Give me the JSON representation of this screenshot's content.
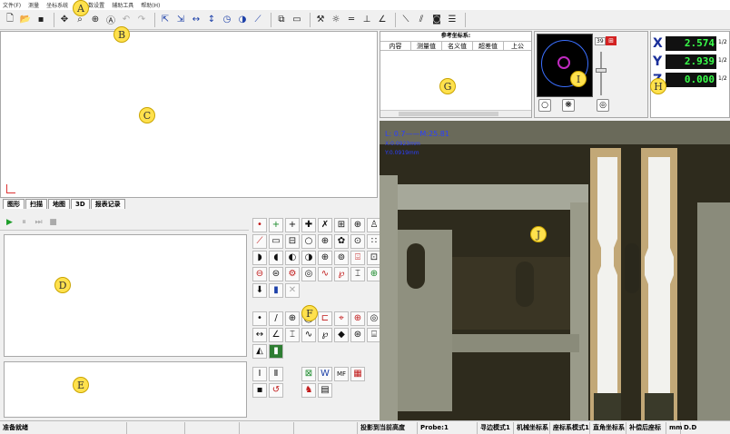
{
  "menu": [
    "文件(F)",
    "测量",
    "坐标系统",
    "",
    "参数设置",
    "辅助工具",
    "帮助(H)"
  ],
  "markers": {
    "A": "A",
    "B": "B",
    "C": "C",
    "D": "D",
    "E": "E",
    "F": "F",
    "G": "G",
    "H": "H",
    "I": "I",
    "J": "J"
  },
  "bottom_tabs": [
    "图形",
    "扫描",
    "地图",
    "3D",
    "报表记录"
  ],
  "reference": {
    "title": "参考坐标系:",
    "columns": [
      "内容",
      "测量值",
      "名义值",
      "超差值",
      "上公"
    ]
  },
  "camera": {
    "zoom_value": "39"
  },
  "dro": {
    "x_label": "X",
    "x_value": "2.574",
    "x_res": "1/2",
    "y_label": "Y",
    "y_value": "2.939",
    "y_res": "1/2",
    "z_label": "Z",
    "z_value": "0.000",
    "z_res": "1/2"
  },
  "video_overlay": {
    "line1": "L: 0.7——M:25.81",
    "line2": "X:0.0923mm",
    "line3": "Y:0.0919mm"
  },
  "toolbar_icons": [
    "new-icon",
    "open-icon",
    "save-icon",
    "move-icon",
    "zoom-icon",
    "crosshair-icon",
    "text-icon",
    "undo-icon",
    "redo-icon",
    "arrow-icon",
    "arrow2-icon",
    "width-icon",
    "height-icon",
    "circle-icon",
    "circle2-icon",
    "line-icon",
    "box-icon",
    "window-icon",
    "tools-icon",
    "sun-icon",
    "parallel-icon",
    "perpendicular-icon",
    "angle-icon",
    "line-tool-icon",
    "distance-icon",
    "cam-icon",
    "list-icon"
  ],
  "tools": {
    "mf_label": "MF"
  },
  "status": {
    "ready": "准备就绪",
    "project_height": "投影到当前高度",
    "probe": "Probe:1",
    "edge_mode": "寻边模式1",
    "machine_coord": "机械坐标系",
    "coord_mode": "座标系模式1",
    "rect_coord": "直角坐标系",
    "comp_coord": "补偿后座标",
    "unit": "mm",
    "decimal": "D.D"
  }
}
